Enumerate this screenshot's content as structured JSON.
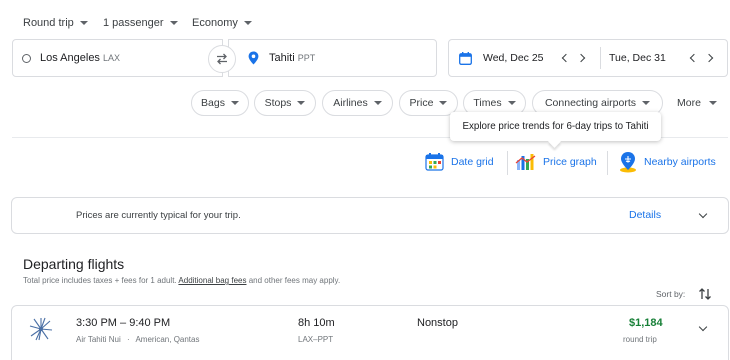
{
  "search": {
    "trip_type": "Round trip",
    "passengers": "1 passenger",
    "cabin_class": "Economy",
    "origin_city": "Los Angeles",
    "origin_code": "LAX",
    "destination_city": "Tahiti",
    "destination_code": "PPT",
    "depart_date": "Wed, Dec 25",
    "return_date": "Tue, Dec 31"
  },
  "filters": {
    "chips": [
      "Bags",
      "Stops",
      "Airlines",
      "Price",
      "Times",
      "Connecting airports"
    ],
    "more": "More"
  },
  "tooltip": "Explore price trends for 6-day trips to Tahiti",
  "tools": {
    "date_grid": "Date grid",
    "price_graph": "Price graph",
    "nearby_airports": "Nearby airports"
  },
  "banner": {
    "text": "Prices are currently typical for your trip.",
    "details": "Details"
  },
  "results": {
    "title": "Departing flights",
    "note_prefix": "Total price includes taxes + fees for 1 adult.",
    "note_link": "Additional bag fees",
    "note_suffix": "and other fees may apply.",
    "sort_label": "Sort by:"
  },
  "flights": [
    {
      "times": "3:30 PM – 9:40 PM",
      "airline": "Air Tahiti Nui",
      "partner": "American, Qantas",
      "duration": "8h 10m",
      "route": "LAX–PPT",
      "stops": "Nonstop",
      "price": "$1,184",
      "price_type": "round trip"
    }
  ],
  "colors": {
    "accent": "#1a73e8",
    "price_green": "#188038",
    "border": "#dadce0"
  }
}
